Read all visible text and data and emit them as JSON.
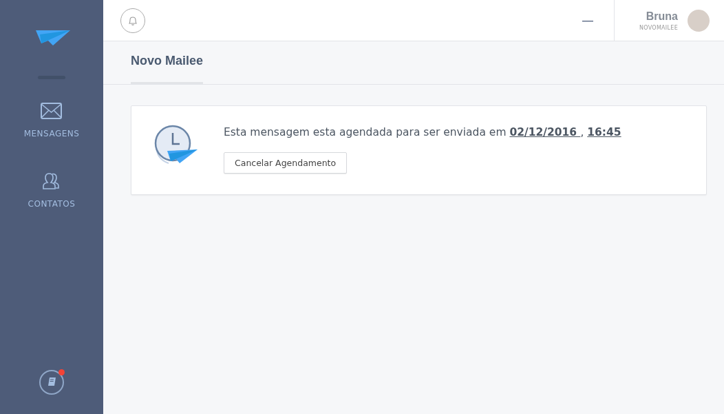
{
  "sidebar": {
    "items": [
      {
        "label": "MENSAGENS",
        "kind": "mail"
      },
      {
        "label": "CONTATOS",
        "kind": "contacts"
      }
    ],
    "help": {
      "notification": true
    }
  },
  "header": {
    "user": {
      "name": "Bruna",
      "account": "NOVOMAILEE"
    }
  },
  "page": {
    "tabs": [
      {
        "label": "Novo Mailee",
        "selected": true
      }
    ]
  },
  "notice": {
    "text": "Esta mensagem esta agendada para ser enviada em",
    "date": "02/12/2016 ",
    "separator": ",",
    "time": "16:45",
    "button": "Cancelar Agendamento"
  }
}
